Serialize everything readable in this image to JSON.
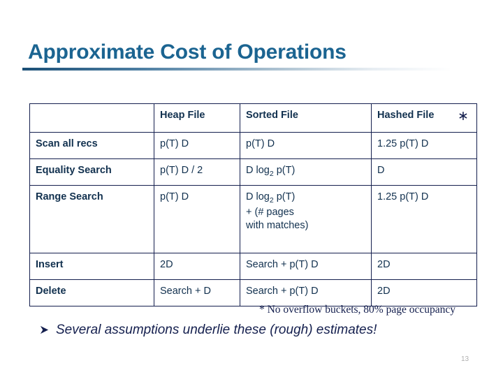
{
  "slide": {
    "title": "Approximate Cost of Operations",
    "page_number": "13",
    "asterisk_marker": "∗",
    "accent_color": "#1b6491",
    "text_color": "#12314f",
    "border_color": "#141f4e"
  },
  "table": {
    "headers": [
      "",
      "Heap File",
      "Sorted File",
      "Hashed File"
    ],
    "rows": [
      {
        "label": "Scan all recs",
        "heap": "p(T) D",
        "sorted": "p(T) D",
        "sorted_line2": "",
        "sorted_line3": "",
        "hashed": "1.25 p(T) D"
      },
      {
        "label": "Equality Search",
        "heap": "p(T) D / 2",
        "sorted_prefix": "D log",
        "sorted_sub": "2",
        "sorted_suffix": " p(T)",
        "hashed": "D"
      },
      {
        "label": "Range Search",
        "heap": "p(T) D",
        "sorted_prefix": "D log",
        "sorted_sub": "2",
        "sorted_suffix": " p(T)",
        "sorted_line2": "+ (# pages",
        "sorted_line3": "with matches)",
        "hashed": "1.25 p(T) D"
      },
      {
        "label": "Insert",
        "heap": "2D",
        "sorted": "Search + p(T) D",
        "hashed": "2D"
      },
      {
        "label": "Delete",
        "heap": "Search + D",
        "sorted": "Search + p(T) D",
        "hashed": "2D"
      }
    ]
  },
  "footnote": "* No overflow buckets, 80% page occupancy",
  "bullet": {
    "icon": "arrow-bullet-icon",
    "text": "Several assumptions underlie these (rough) estimates!"
  }
}
